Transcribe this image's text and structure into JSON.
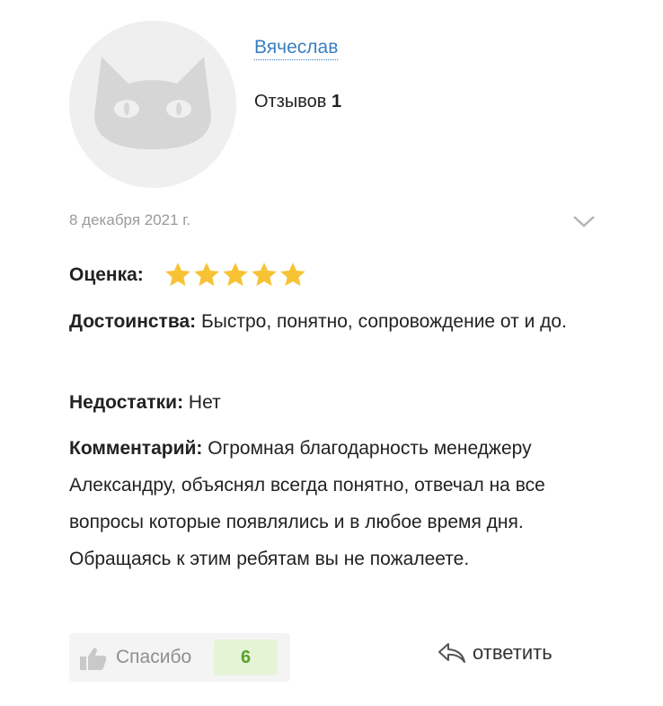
{
  "user": {
    "name": "Вячеслав",
    "reviews_label": "Отзывов",
    "reviews_count": "1",
    "avatar_icon": "cat-icon"
  },
  "review": {
    "date": "8 декабря 2021 г.",
    "rating": {
      "label": "Оценка:",
      "value": 5,
      "max": 5,
      "star_color": "#f7c334"
    },
    "pros": {
      "label": "Достоинства:",
      "text": "Быстро, понятно, сопровождение от и до."
    },
    "cons": {
      "label": "Недостатки:",
      "text": "Нет"
    },
    "comment": {
      "label": "Комментарий:",
      "text": "Огромная благодарность менеджеру Александру, объяснял всегда понятно, отвечал на все вопросы которые появлялись и в любое время дня. Обращаясь к этим ребятам вы не пожалеете."
    }
  },
  "actions": {
    "thanks_label": "Спасибо",
    "thanks_count": "6",
    "reply_label": "ответить"
  },
  "colors": {
    "link": "#3a7fc1",
    "thanks_count_bg": "#e6f4d6",
    "thanks_count_text": "#58a32a"
  }
}
